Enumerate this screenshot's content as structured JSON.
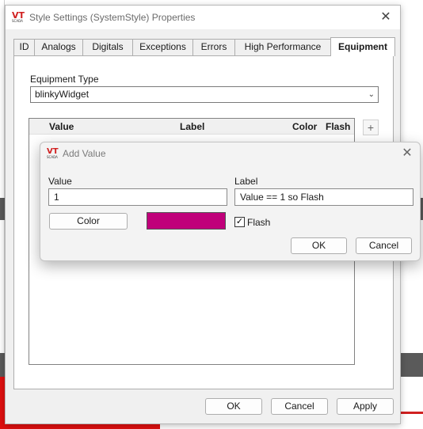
{
  "window": {
    "title": "Style Settings (SystemStyle) Properties",
    "icon": "vtscada-logo-icon",
    "logo_text": "VT",
    "logo_sub": "SCADA"
  },
  "tabs": [
    {
      "label": "ID"
    },
    {
      "label": "Analogs"
    },
    {
      "label": "Digitals"
    },
    {
      "label": "Exceptions"
    },
    {
      "label": "Errors"
    },
    {
      "label": "High Performance"
    },
    {
      "label": "Equipment",
      "active": true
    }
  ],
  "equipment": {
    "type_label": "Equipment Type",
    "type_value": "blinkyWidget"
  },
  "table": {
    "columns": [
      "Value",
      "Label",
      "Color",
      "Flash"
    ],
    "rows": []
  },
  "side_buttons": {
    "add": "+"
  },
  "footer": {
    "ok": "OK",
    "cancel": "Cancel",
    "apply": "Apply"
  },
  "dialog": {
    "title": "Add Value",
    "value_label": "Value",
    "value": "1",
    "label_label": "Label",
    "label_value": "Value == 1 so Flash",
    "color_button": "Color",
    "color_value": "#c0007a",
    "flash_label": "Flash",
    "flash_checked": true,
    "ok": "OK",
    "cancel": "Cancel"
  }
}
